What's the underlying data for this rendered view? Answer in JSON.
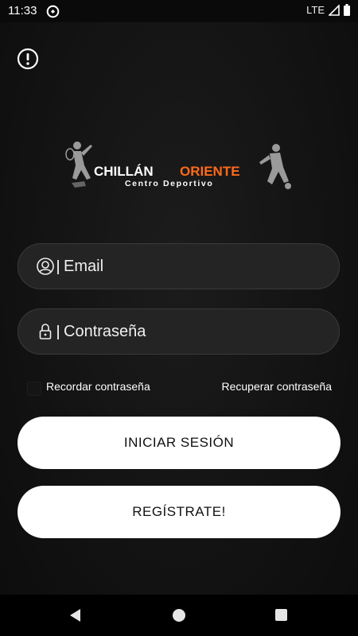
{
  "status_bar": {
    "time": "11:33",
    "network": "LTE"
  },
  "logo": {
    "brand_white": "CHILLÁN",
    "brand_orange": "ORIENTE",
    "tagline": "Centro Deportivo",
    "accent_color": "#ff6a1a"
  },
  "login": {
    "email_placeholder": "Email",
    "password_placeholder": "Contraseña",
    "remember_label": "Recordar contraseña",
    "recover_label": "Recuperar contraseña",
    "login_button": "INICIAR SESIÓN",
    "register_button": "REGÍSTRATE!"
  },
  "icons": {
    "alert": "alert-circle-icon",
    "email": "user-circle-icon",
    "password": "lock-icon"
  }
}
